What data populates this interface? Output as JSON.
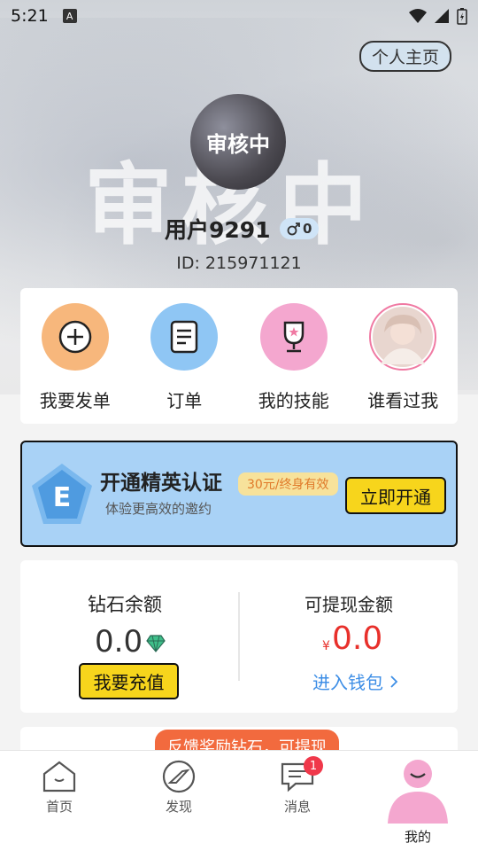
{
  "status_bar": {
    "time": "5:21",
    "notification_badge": "A"
  },
  "header": {
    "home_button": "个人主页",
    "avatar_text": "审核中",
    "watermark": "审核中",
    "username": "用户9291",
    "gender_count": "0",
    "user_id": "ID: 215971121"
  },
  "quick_actions": [
    {
      "label": "我要发单",
      "icon": "plus-icon",
      "color": "#f7b77c"
    },
    {
      "label": "订单",
      "icon": "document-icon",
      "color": "#8fc6f4"
    },
    {
      "label": "我的技能",
      "icon": "trophy-icon",
      "color": "#f4a7cf"
    },
    {
      "label": "谁看过我",
      "icon": "visitor-avatar",
      "color": "#f07aa3"
    }
  ],
  "elite_banner": {
    "badge_letter": "E",
    "title": "开通精英认证",
    "price_tag": "30元/终身有效",
    "subtitle": "体验更高效的邀约",
    "button": "立即开通"
  },
  "wallet": {
    "diamond_label": "钻石余额",
    "diamond_value": "0.0",
    "recharge_button": "我要充值",
    "cash_label": "可提现金额",
    "currency_symbol": "¥",
    "cash_value": "0.0",
    "wallet_link": "进入钱包"
  },
  "feedback": {
    "text": "反馈奖励钻石，可提现"
  },
  "bottom_nav": {
    "items": [
      {
        "label": "首页",
        "icon": "home-icon"
      },
      {
        "label": "发现",
        "icon": "compass-icon"
      },
      {
        "label": "消息",
        "icon": "message-icon",
        "badge": "1"
      },
      {
        "label": "我的",
        "icon": "profile-icon"
      }
    ]
  },
  "colors": {
    "accent_yellow": "#f7d51c",
    "elite_blue": "#a9d2f6",
    "cash_red": "#e8302b",
    "link_blue": "#3d8ee6",
    "profile_pink": "#f4a7cf"
  }
}
